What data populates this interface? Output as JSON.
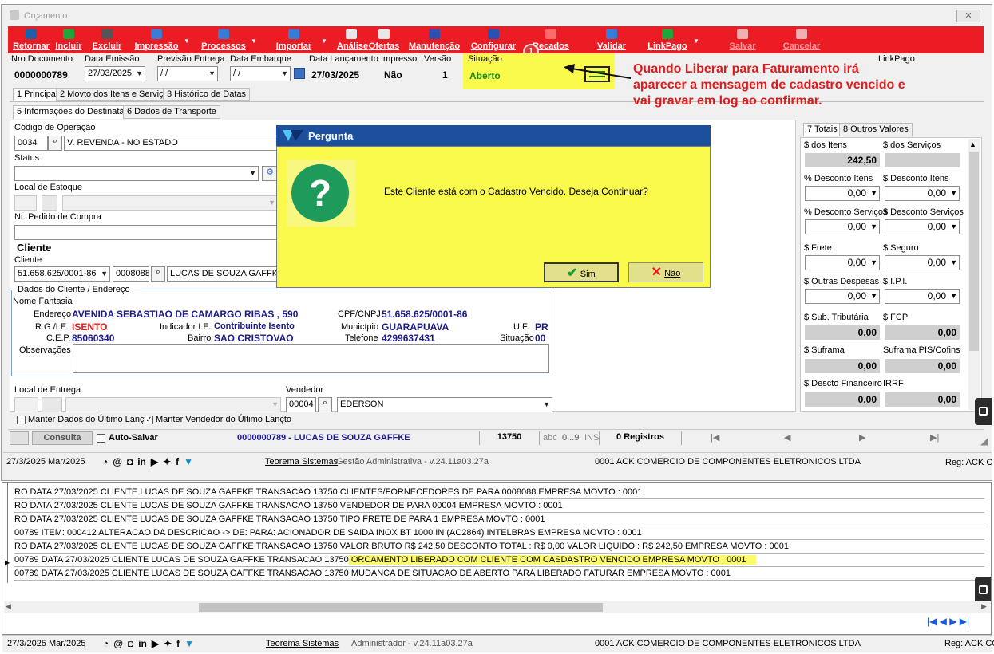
{
  "window": {
    "title": "Orçamento",
    "close": "✕"
  },
  "toolbar": [
    {
      "label": "Retornar",
      "color": "#1f5fa8"
    },
    {
      "label": "Incluir",
      "color": "#1fa53a"
    },
    {
      "label": "Excluir",
      "color": "#555555"
    },
    {
      "label": "Impressão",
      "color": "#3a7bd5"
    },
    {
      "label": "Processos",
      "color": "#3a7bd5"
    },
    {
      "label": "Importar",
      "color": "#3a7bd5"
    },
    {
      "label": "Análise",
      "color": "#e8e8e8"
    },
    {
      "label": "Ofertas",
      "color": "#e8e8e8"
    },
    {
      "label": "Manutenção",
      "color": "#2c4fb0"
    },
    {
      "label": "Configurar",
      "color": "#2c4fb0"
    },
    {
      "label": "Recados",
      "color": "#ff6a6a"
    },
    {
      "label": "Validar",
      "color": "#3a7bd5"
    },
    {
      "label": "LinkPago",
      "color": "#1fa53a"
    },
    {
      "label": "Salvar",
      "color": "#f0b0b0"
    },
    {
      "label": "Cancelar",
      "color": "#f0b0b0"
    }
  ],
  "badge": "1",
  "header": {
    "nro_label": "Nro Documento",
    "nro_value": "0000000789",
    "emissao_label": "Data Emissão",
    "emissao_value": "27/03/2025",
    "previsao_label": "Previsão Entrega",
    "previsao_value": "/ /",
    "embarque_label": "Data Embarque",
    "embarque_value": "/ /",
    "lancamento_label": "Data Lançamento",
    "lancamento_value": "27/03/2025",
    "impresso_label": "Impresso",
    "impresso_value": "Não",
    "versao_label": "Versão",
    "versao_value": "1",
    "situacao_label": "Situação",
    "situacao_value": "Aberto",
    "linkpago_label": "LinkPago"
  },
  "annotation": {
    "line1": "Quando Liberar para Faturamento irá",
    "line2": "aparecer a mensagem de cadastro vencido e",
    "line3": "vai gravar em log ao confirmar."
  },
  "tabs_main": [
    "1 Principal",
    "2 Movto dos Itens e Serviços",
    "3 Histórico de Datas"
  ],
  "tabs_sub": [
    "5 Informações do Destinatário",
    "6 Dados de Transporte"
  ],
  "form": {
    "cod_operacao_label": "Código de Operação",
    "cod_operacao": "0034",
    "operacao_desc": "V. REVENDA - NO ESTADO",
    "status_label": "Status",
    "local_estoque_label": "Local de Estoque",
    "pedido_compra_label": "Nr. Pedido de Compra",
    "cliente_section": "Cliente",
    "cliente_label": "Cliente",
    "cliente_cnpj": "51.658.625/0001-86",
    "cliente_cod": "0008088",
    "cliente_nome": "LUCAS DE SOUZA GAFFKE",
    "dados_cliente_label": "Dados do Cliente / Endereço",
    "nome_fantasia_label": "Nome Fantasia",
    "endereco_label": "Endereço",
    "endereco_value": "AVENIDA SEBASTIAO DE CAMARGO RIBAS , 590",
    "cpf_label": "CPF/CNPJ",
    "cpf_value": "51.658.625/0001-86",
    "rg_label": "R.G./I.E.",
    "rg_value": "ISENTO",
    "indicador_label": "Indicador I.E.",
    "indicador_value": "Contribuinte Isento",
    "municipio_label": "Município",
    "municipio_value": "GUARAPUAVA",
    "uf_label": "U.F.",
    "uf_value": "PR",
    "cep_label": "C.E.P.",
    "cep_value": "85060340",
    "bairro_label": "Bairro",
    "bairro_value": "SAO CRISTOVAO",
    "telefone_label": "Telefone",
    "telefone_value": "4299637431",
    "situacao_label": "Situação",
    "situacao_value": "00",
    "observacoes_label": "Observações",
    "local_entrega_label": "Local de Entrega",
    "vendedor_label": "Vendedor",
    "vendedor_cod": "00004",
    "vendedor_nome": "EDERSON",
    "manter_dados": "Manter Dados do Último Lançto",
    "manter_vendedor": "Manter Vendedor do Último Lançto"
  },
  "dialog": {
    "title": "Pergunta",
    "message": "Este Cliente está com o Cadastro Vencido. Deseja Continuar?",
    "yes": "Sim",
    "no": "Não",
    "icon": "?"
  },
  "totals_tabs": [
    "7 Totais",
    "8 Outros Valores"
  ],
  "totals": {
    "dos_itens_label": "$ dos Itens",
    "dos_itens": "242,50",
    "dos_servicos_label": "$ dos Serviços",
    "desc_itens_pct_label": "% Desconto Itens",
    "desc_itens_pct": "0,00",
    "desc_itens_label": "$ Desconto Itens",
    "desc_itens": "0,00",
    "desc_serv_pct_label": "% Desconto Serviços",
    "desc_serv_pct": "0,00",
    "desc_serv_label": "$ Desconto Serviços",
    "desc_serv": "0,00",
    "frete_label": "$ Frete",
    "frete": "0,00",
    "seguro_label": "$ Seguro",
    "seguro": "0,00",
    "outras_label": "$ Outras Despesas",
    "outras": "0,00",
    "ipi_label": "$ I.P.I.",
    "ipi": "0,00",
    "subtrib_label": "$ Sub. Tributária",
    "subtrib": "0,00",
    "fcp_label": "$ FCP",
    "fcp": "0,00",
    "suframa_label": "$ Suframa",
    "suframa": "0,00",
    "suframa_pis_label": "Suframa PIS/Cofins",
    "suframa_pis": "0,00",
    "desc_fin_label": "$ Descto Financeiro",
    "desc_fin": "0,00",
    "irrf_label": "IRRF",
    "irrf": "0,00"
  },
  "navbar": {
    "consulta": "Consulta",
    "auto_salvar": "Auto-Salvar",
    "doc": "0000000789 - LUCAS DE SOUZA GAFFKE",
    "transacao": "13750",
    "abc": "abc",
    "num": "0...9",
    "ins": "INS",
    "registros": "0 Registros"
  },
  "status1": {
    "date": "27/3/2025 Mar/2025",
    "teorema": "Teorema Sistemas",
    "gestao": "Gestão Administrativa - v.24.11a03.27a",
    "empresa": "0001 ACK COMERCIO DE COMPONENTES ELETRONICOS LTDA",
    "reg": "Reg: ACK CO"
  },
  "log_rows": [
    {
      "a": "RO DATA 27/03/2025 CLIENTE LUCAS DE SOUZA GAFFKE TRANSACAO 13750 CLIENTES/FORNECEDORES DE PARA 0008088 EMPRESA MOVTO : 0001",
      "b": ""
    },
    {
      "a": "RO DATA 27/03/2025 CLIENTE LUCAS DE SOUZA GAFFKE TRANSACAO 13750 VENDEDOR DE PARA 00004 EMPRESA MOVTO : 0001",
      "b": ""
    },
    {
      "a": "RO DATA 27/03/2025 CLIENTE LUCAS DE SOUZA GAFFKE TRANSACAO 13750 TIPO FRETE DE PARA 1 EMPRESA MOVTO : 0001",
      "b": ""
    },
    {
      "a": "00789 ITEM: 000412 ALTERACAO DA DESCRICAO -> DE: PARA: ACIONADOR DE SAIDA INOX BT 1000 IN (AC2864) INTELBRAS EMPRESA MOVTO : 0001",
      "b": ""
    },
    {
      "a": "RO DATA 27/03/2025 CLIENTE LUCAS DE SOUZA GAFFKE TRANSACAO 13750 VALOR BRUTO R$ 242,50 DESCONTO TOTAL : R$ 0,00 VALOR LIQUIDO : R$ 242,50 EMPRESA MOVTO : 0001",
      "b": ""
    },
    {
      "a": "00789 DATA 27/03/2025 CLIENTE LUCAS DE SOUZA GAFFKE TRANSACAO 13750",
      "b": " ORCAMENTO LIBERADO COM CLIENTE COM CASDASTRO VENCIDO EMPRESA MOVTO : 0001"
    },
    {
      "a": "00789 DATA 27/03/2025 CLIENTE LUCAS DE SOUZA GAFFKE TRANSACAO 13750 MUDANCA DE SITUACAO DE ABERTO PARA LIBERADO FATURAR EMPRESA MOVTO : 0001",
      "b": ""
    }
  ],
  "status2": {
    "date": "27/3/2025 Mar/2025",
    "teorema": "Teorema Sistemas",
    "admin": "Administrador - v.24.11a03.27a",
    "empresa": "0001 ACK COMERCIO DE COMPONENTES ELETRONICOS LTDA",
    "reg": "Reg: ACK CO"
  },
  "status_icons": [
    "◔",
    "@",
    "◘",
    "in",
    "▶",
    "✦",
    "f",
    "▼"
  ],
  "colors": {
    "toolbar": "#ec1c24",
    "dialog_title": "#1c4f9c",
    "dialog_body": "#fafa4c",
    "annotation": "#e01b1b",
    "value_blue": "#1a1a8c",
    "value_red": "#e01b1b"
  }
}
